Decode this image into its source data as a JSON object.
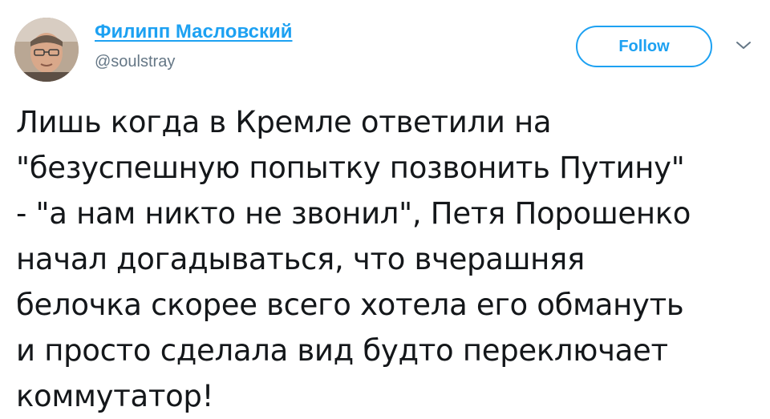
{
  "tweet": {
    "author": {
      "display_name": "Филипп Масловский",
      "handle": "@soulstray",
      "avatar_icon": "user-avatar-photo"
    },
    "follow_label": "Follow",
    "menu_icon": "chevron-down-icon",
    "lines": [
      "Лишь когда в Кремле ответили на",
      "\"безуспешную попытку позвонить Путину\"",
      "- \"а нам никто не звонил\", Петя Порошенко",
      "начал догадываться, что вчерашняя",
      "белочка скорее всего хотела его обмануть",
      "и просто сделала вид будто переключает",
      "коммутатор!"
    ]
  },
  "colors": {
    "accent": "#1da1f2",
    "text": "#14171a",
    "secondary": "#657786"
  }
}
